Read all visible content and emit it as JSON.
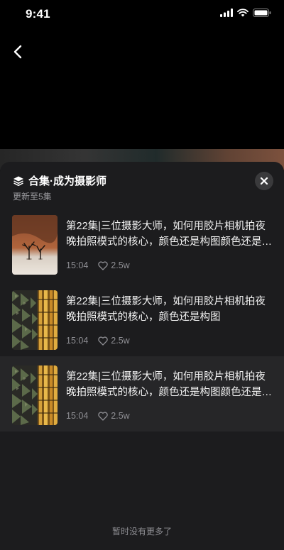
{
  "status": {
    "time": "9:41"
  },
  "sheet": {
    "title": "合集·成为摄影师",
    "subtitle": "更新至5集",
    "footer": "暂时没有更多了"
  },
  "items": [
    {
      "title": "第22集|三位摄影大师，如何用胶片相机拍夜晚拍照模式的核心，颜色还是构图颜色还是构图",
      "duration": "15:04",
      "likes": "2.5w",
      "thumb": "desert-trees"
    },
    {
      "title": "第22集|三位摄影大师，如何用胶片相机拍夜晚拍照模式的核心，颜色还是构图",
      "duration": "15:04",
      "likes": "2.5w",
      "thumb": "building-facade"
    },
    {
      "title": "第22集|三位摄影大师，如何用胶片相机拍夜晚拍照模式的核心，颜色还是构图颜色还是构图",
      "duration": "15:04",
      "likes": "2.5w",
      "thumb": "building-facade"
    }
  ],
  "colors": {
    "sheet_bg": "#1c1c1e",
    "active_row": "#262628",
    "muted_text": "#8e8e93"
  }
}
